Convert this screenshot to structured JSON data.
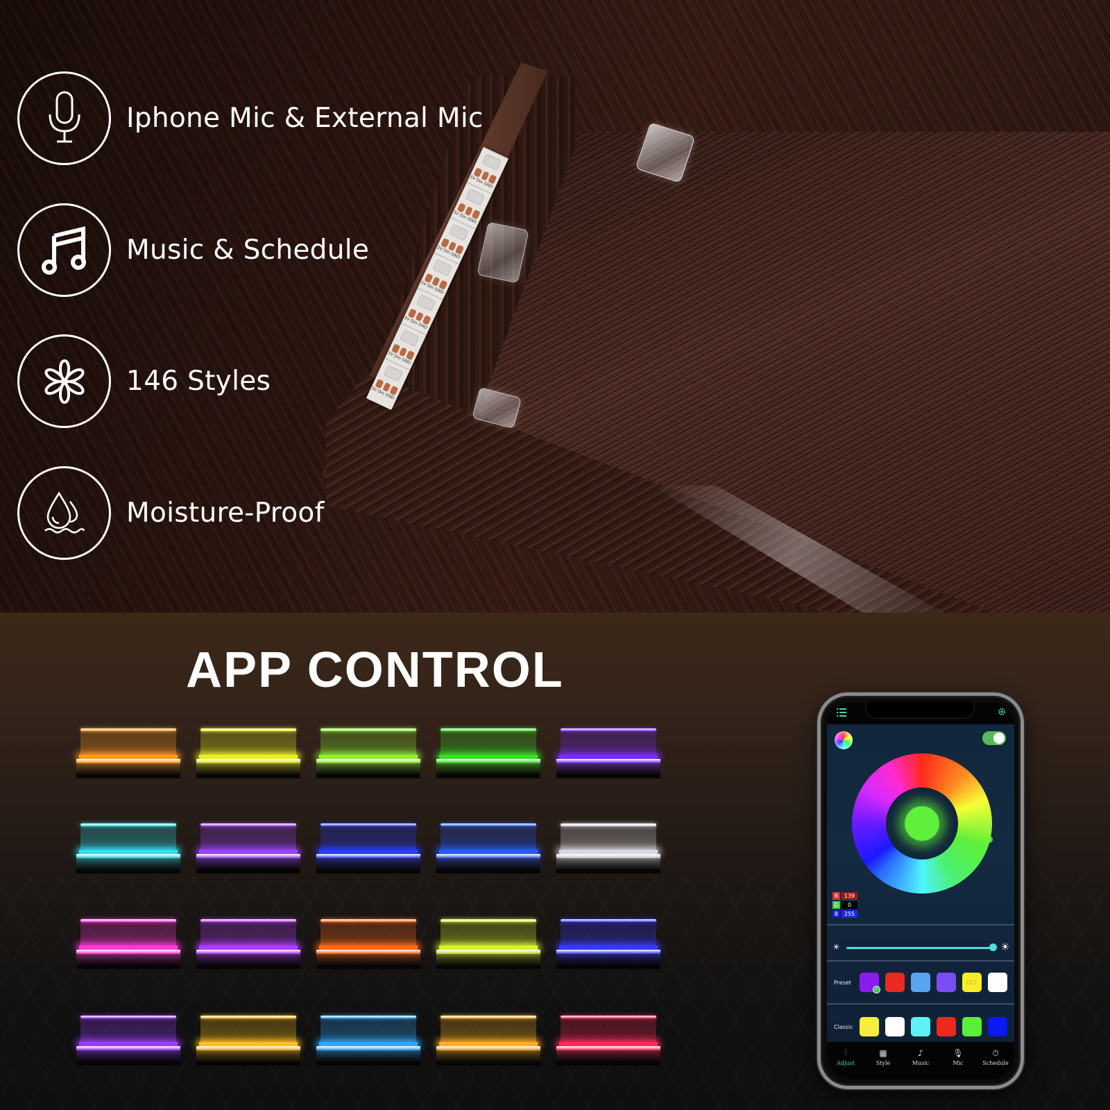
{
  "features": [
    {
      "icon": "microphone-icon",
      "label": "Iphone Mic & External Mic"
    },
    {
      "icon": "music-note-icon",
      "label": "Music & Schedule"
    },
    {
      "icon": "flower-styles-icon",
      "label": "146 Styles"
    },
    {
      "icon": "water-drops-icon",
      "label": "Moisture-Proof"
    }
  ],
  "led_strip": {
    "pad_label": "5V Din GND"
  },
  "app_section": {
    "title": "APP CONTROL",
    "shelf_colors": [
      [
        "#ff9a1e",
        "#e8f020",
        "#8cf02e",
        "#38e024",
        "#7a2cff"
      ],
      [
        "#2ee0f0",
        "#9a44ff",
        "#2a3cff",
        "#2a5aff",
        "#d8d8e0"
      ],
      [
        "#ff3ad8",
        "#b43cff",
        "#ff6a1a",
        "#d8f030",
        "#3a3aff"
      ],
      [
        "#9a3cff",
        "#ffc020",
        "#30a8ff",
        "#ffb020",
        "#ff2a5a"
      ]
    ]
  },
  "phone_app": {
    "power_on": true,
    "selected_color": "#5ef03a",
    "rgb": [
      {
        "key": "R",
        "value": "139",
        "key_color": "#d9322a",
        "value_color": "#9a1d1a"
      },
      {
        "key": "G",
        "value": "0",
        "key_color": "#3fd43a",
        "value_color": "#000000"
      },
      {
        "key": "B",
        "value": "255",
        "key_color": "#1a1ae0",
        "value_color": "#1a2ae0"
      }
    ],
    "brightness_percent": 100,
    "preset": {
      "label": "Preset",
      "swatches": [
        {
          "color": "#8a1cf0",
          "text": "",
          "selected": true
        },
        {
          "color": "#e82a22",
          "text": ""
        },
        {
          "color": "#5aa4ee",
          "text": ""
        },
        {
          "color": "#7a4ef4",
          "text": ""
        },
        {
          "color": "#f6ee2a",
          "text": "CCT"
        },
        {
          "color": "#ffffff",
          "text": ""
        }
      ]
    },
    "classic": {
      "label": "Classic",
      "swatches": [
        {
          "color": "#f6ee3a"
        },
        {
          "color": "#ffffff"
        },
        {
          "color": "#5ef0f4"
        },
        {
          "color": "#ec2a1e"
        },
        {
          "color": "#5cec3a"
        },
        {
          "color": "#0a1af0"
        }
      ]
    },
    "tabs": [
      {
        "icon": "sliders-icon",
        "glyph": "⫶",
        "label": "Adjust",
        "active": true
      },
      {
        "icon": "grid-icon",
        "glyph": "▦",
        "label": "Style",
        "active": false
      },
      {
        "icon": "music-icon",
        "glyph": "♪",
        "label": "Music",
        "active": false
      },
      {
        "icon": "mic-icon",
        "glyph": "🎙",
        "label": "Mic",
        "active": false
      },
      {
        "icon": "timer-icon",
        "glyph": "⏱",
        "label": "Schedule",
        "active": false
      }
    ]
  }
}
